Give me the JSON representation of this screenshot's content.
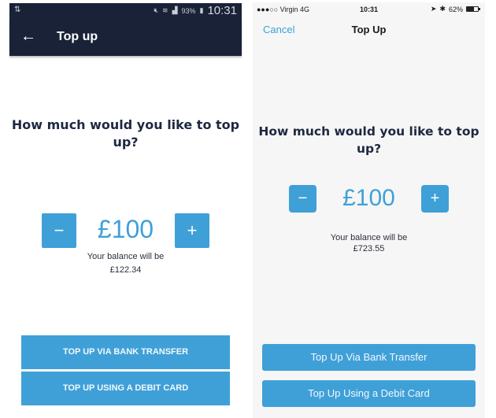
{
  "android": {
    "status_bar": {
      "left_icon": "data-transfer-icon",
      "icons": [
        "mute-icon",
        "wifi-icon",
        "signal-icon"
      ],
      "battery_percent": "93%",
      "time": "10:31"
    },
    "app_bar": {
      "back_icon": "←",
      "title": "Top up"
    },
    "question": "How much would you like to top up?",
    "stepper": {
      "minus_label": "−",
      "amount": "£100",
      "plus_label": "+"
    },
    "balance": {
      "label": "Your balance will be",
      "value": "£122.34"
    },
    "buttons": {
      "bank_transfer": "TOP UP VIA BANK TRANSFER",
      "debit_card": "TOP UP USING A DEBIT CARD"
    }
  },
  "ios": {
    "status_bar": {
      "carrier": "●●●○○ Virgin  4G",
      "time": "10:31",
      "location_icon": "➤",
      "bluetooth_icon": "✱",
      "battery_percent": "62%",
      "battery_level": 0.62
    },
    "nav": {
      "cancel": "Cancel",
      "title": "Top Up"
    },
    "question": "How much would you like to top up?",
    "stepper": {
      "minus_label": "−",
      "amount": "£100",
      "plus_label": "+"
    },
    "balance": {
      "label": "Your balance will be",
      "value": "£723.55"
    },
    "buttons": {
      "bank_transfer": "Top Up Via Bank Transfer",
      "debit_card": "Top Up Using a Debit Card"
    }
  },
  "colors": {
    "accent": "#3fa0d8",
    "android_bar": "#1a2238",
    "heading": "#1e2840",
    "ios_bg": "#f6f6f6"
  }
}
